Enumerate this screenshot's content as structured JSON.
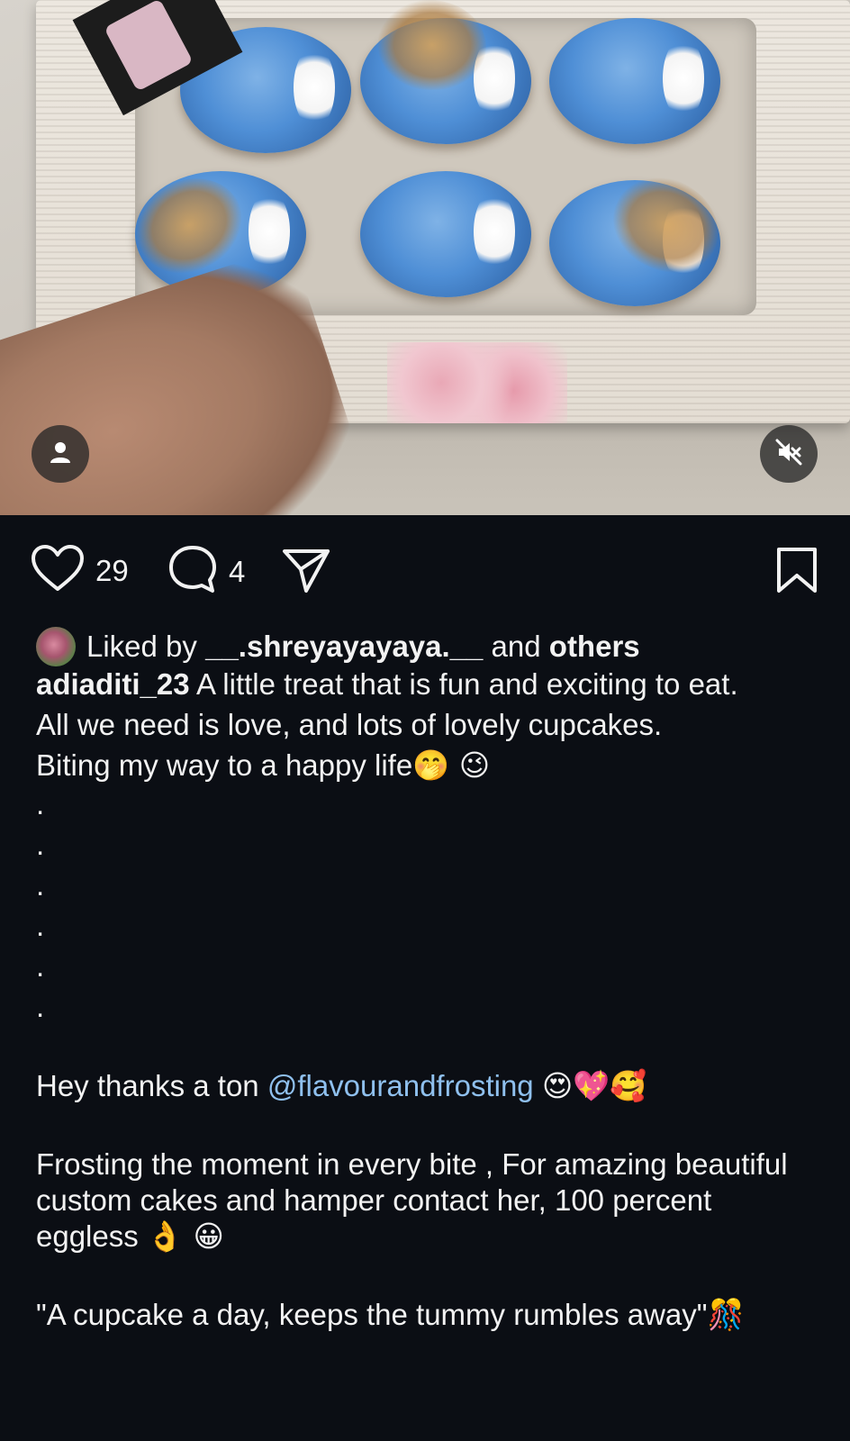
{
  "post": {
    "likes_count": "29",
    "comments_count": "4",
    "liked_by_prefix": "Liked by",
    "liked_by_user": "__.shreyayayaya.__",
    "liked_by_and": "and",
    "liked_by_others": "others",
    "author": "adiaditi_23",
    "caption_line1": "A little treat that is fun and exciting to eat.",
    "caption_line2": "All we need is love, and lots of lovely cupcakes.",
    "caption_line3": "Biting my way to a happy life",
    "caption_line3_emoji": "🤭 😉",
    "dots": [
      ".",
      ".",
      ".",
      ".",
      ".",
      "."
    ],
    "thanks_text": "Hey thanks a ton",
    "mention": "@flavourandfrosting",
    "thanks_emoji": "😍💖🥰",
    "frosting_text": "Frosting the moment in every bite , For amazing beautiful custom cakes and hamper contact her, 100 percent eggless",
    "frosting_emoji": "👌 😀",
    "quote_text": "\"A cupcake a day, keeps the tummy rumbles away\"",
    "quote_emoji": "🎊"
  },
  "icons": {
    "like": "heart-icon",
    "comment": "comment-bubble-icon",
    "share": "send-icon",
    "save": "bookmark-icon",
    "tags": "person-tag-icon",
    "mute": "speaker-muted-icon"
  },
  "colors": {
    "background": "#0b0e14",
    "text": "#f2f2f2",
    "mention": "#8fc0ee"
  }
}
